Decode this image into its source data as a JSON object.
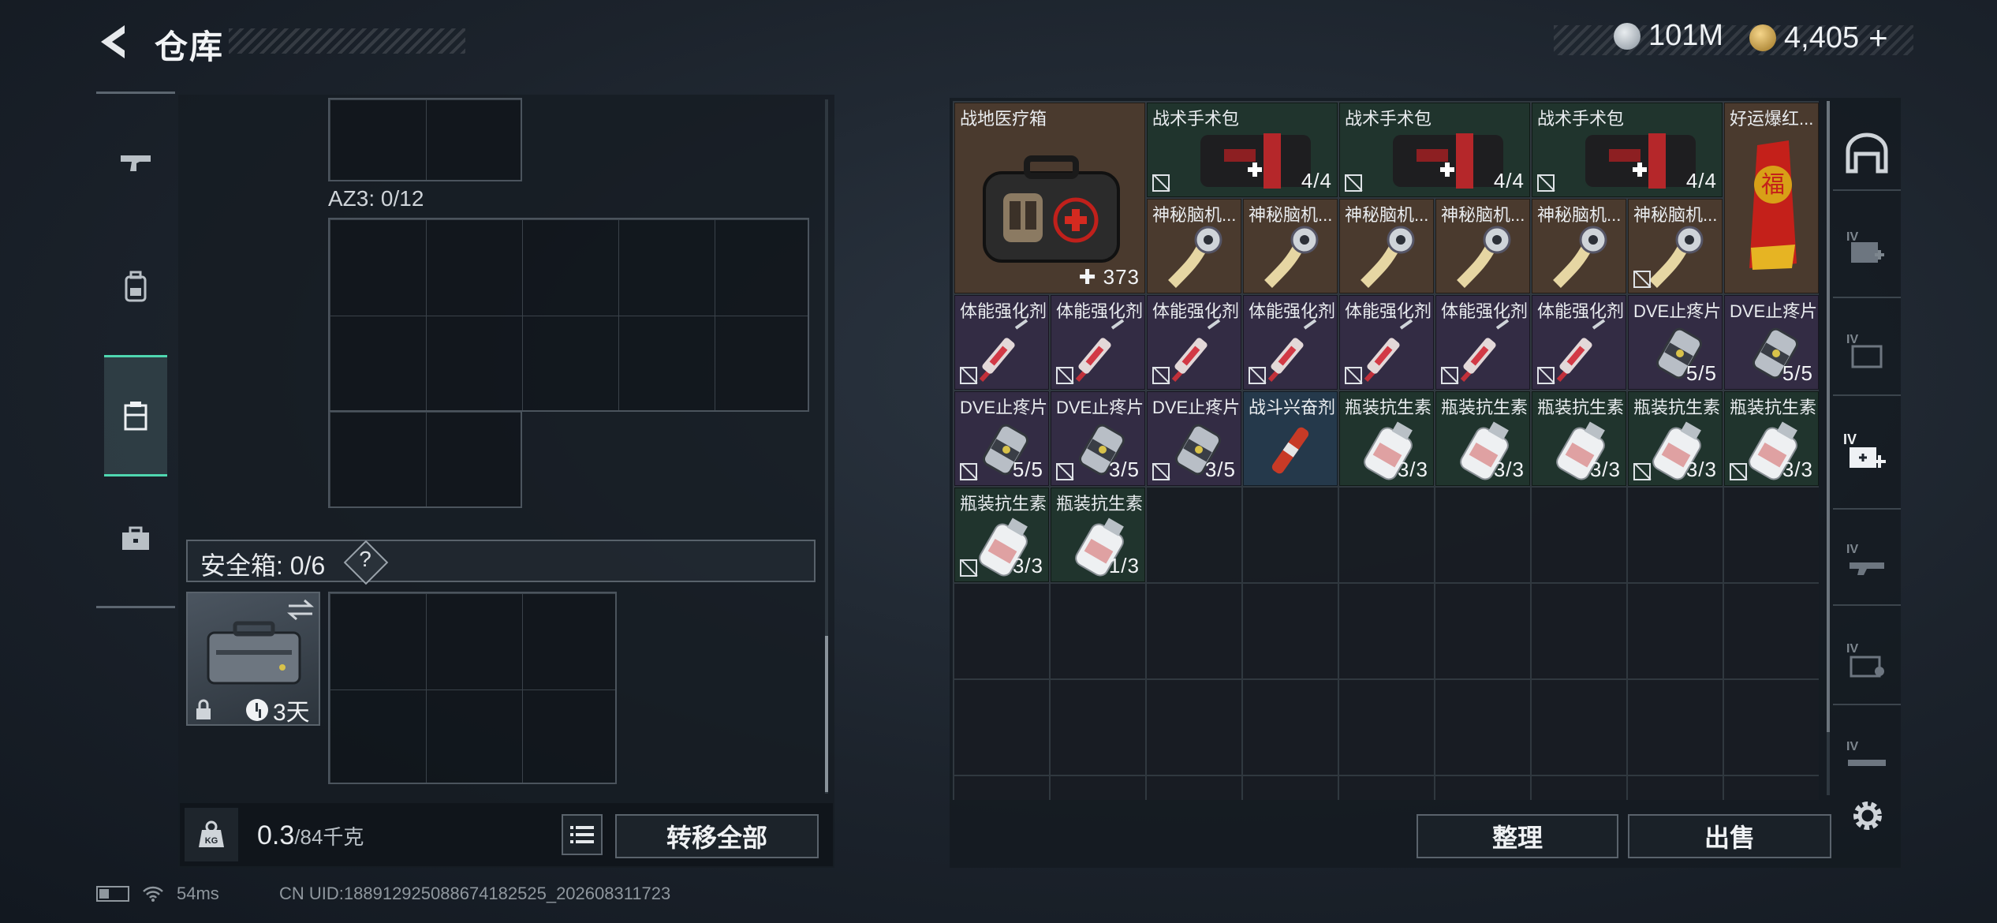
{
  "header": {
    "title": "仓库",
    "currency_silver": "101M",
    "currency_gold": "4,405",
    "currency_gold_plus": "+"
  },
  "left_tabs": [
    "weapons-tab",
    "backpack-tab",
    "storage-tab",
    "case-tab"
  ],
  "left_panel": {
    "az3_label": "AZ3: 0/12",
    "safe_label": "安全箱: 0/6",
    "safe_help": "?",
    "safe_case_days": "3天"
  },
  "bottom_left": {
    "weight_value": "0.3",
    "weight_max": "/84千克",
    "weight_unit_badge": "KG",
    "transfer_all": "转移全部"
  },
  "inventory": {
    "items": [
      {
        "name": "战地医疗箱",
        "count": "373",
        "rarity": "brown"
      },
      {
        "name": "战术手术包",
        "count": "4/4",
        "rarity": "green"
      },
      {
        "name": "战术手术包",
        "count": "4/4",
        "rarity": "green"
      },
      {
        "name": "战术手术包",
        "count": "4/4",
        "rarity": "green"
      },
      {
        "name": "好运爆红...",
        "count": "",
        "rarity": "brown"
      },
      {
        "name": "神秘脑机...",
        "count": "",
        "rarity": "brown"
      },
      {
        "name": "神秘脑机...",
        "count": "",
        "rarity": "brown"
      },
      {
        "name": "神秘脑机...",
        "count": "",
        "rarity": "brown"
      },
      {
        "name": "神秘脑机...",
        "count": "",
        "rarity": "brown"
      },
      {
        "name": "神秘脑机...",
        "count": "",
        "rarity": "brown"
      },
      {
        "name": "神秘脑机...",
        "count": "",
        "rarity": "brown"
      },
      {
        "name": "体能强化剂",
        "count": "",
        "rarity": "purple"
      },
      {
        "name": "体能强化剂",
        "count": "",
        "rarity": "purple"
      },
      {
        "name": "体能强化剂",
        "count": "",
        "rarity": "purple"
      },
      {
        "name": "体能强化剂",
        "count": "",
        "rarity": "purple"
      },
      {
        "name": "体能强化剂",
        "count": "",
        "rarity": "purple"
      },
      {
        "name": "体能强化剂",
        "count": "",
        "rarity": "purple"
      },
      {
        "name": "体能强化剂",
        "count": "",
        "rarity": "purple"
      },
      {
        "name": "DVE止疼片",
        "count": "5/5",
        "rarity": "purple"
      },
      {
        "name": "DVE止疼片",
        "count": "5/5",
        "rarity": "purple"
      },
      {
        "name": "DVE止疼片",
        "count": "5/5",
        "rarity": "purple"
      },
      {
        "name": "DVE止疼片",
        "count": "3/5",
        "rarity": "purple"
      },
      {
        "name": "DVE止疼片",
        "count": "3/5",
        "rarity": "purple"
      },
      {
        "name": "战斗兴奋剂",
        "count": "",
        "rarity": "blue"
      },
      {
        "name": "瓶装抗生素",
        "count": "3/3",
        "rarity": "green"
      },
      {
        "name": "瓶装抗生素",
        "count": "3/3",
        "rarity": "green"
      },
      {
        "name": "瓶装抗生素",
        "count": "3/3",
        "rarity": "green"
      },
      {
        "name": "瓶装抗生素",
        "count": "3/3",
        "rarity": "green"
      },
      {
        "name": "瓶装抗生素",
        "count": "3/3",
        "rarity": "green"
      },
      {
        "name": "瓶装抗生素",
        "count": "3/3",
        "rarity": "green"
      },
      {
        "name": "瓶装抗生素",
        "count": "1/3",
        "rarity": "green"
      }
    ],
    "sort_button": "整理",
    "sell_button": "出售"
  },
  "status_bar": {
    "ping": "54ms",
    "uid": "CN UID:1889129250886741825​25_202608311723"
  },
  "colors": {
    "accent": "#4fd7b0",
    "rarity_brown": "#4a3a2e",
    "rarity_green": "#20342d",
    "rarity_purple": "#332c44",
    "rarity_blue": "#25394b"
  }
}
